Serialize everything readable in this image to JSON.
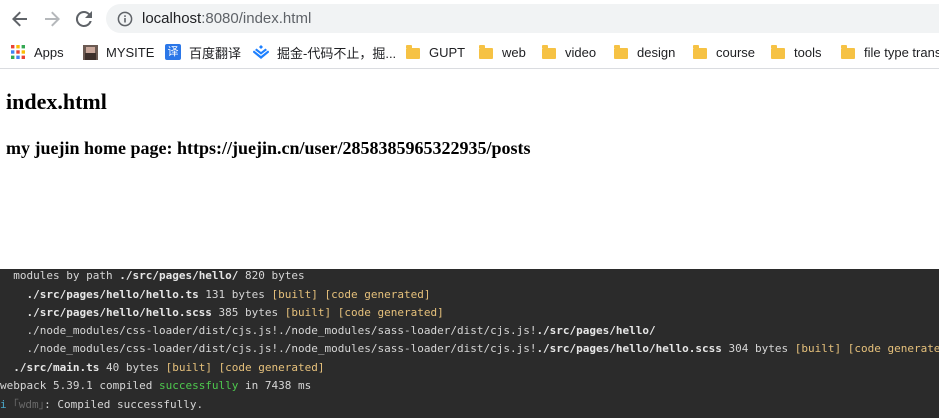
{
  "browser": {
    "url_host": "localhost",
    "url_rest": ":8080/index.html",
    "bookmarks": [
      {
        "label": "Apps",
        "icon": "apps-grid-icon"
      },
      {
        "label": "MYSITE",
        "icon": "mysite-favicon"
      },
      {
        "label": "百度翻译",
        "icon": "baidu-translate-icon"
      },
      {
        "label": "掘金-代码不止，掘...",
        "icon": "juejin-icon"
      },
      {
        "label": "GUPT",
        "icon": "folder-icon"
      },
      {
        "label": "web",
        "icon": "folder-icon"
      },
      {
        "label": "video",
        "icon": "folder-icon"
      },
      {
        "label": "design",
        "icon": "folder-icon"
      },
      {
        "label": "course",
        "icon": "folder-icon"
      },
      {
        "label": "tools",
        "icon": "folder-icon"
      },
      {
        "label": "file type trans",
        "icon": "folder-icon"
      }
    ],
    "translate_glyph": "译"
  },
  "page": {
    "heading": "index.html",
    "subheading": "my juejin home page: https://juejin.cn/user/2858385965322935/posts"
  },
  "terminal": {
    "line1": {
      "prefix": "  modules by path ",
      "path": "./src/pages/hello/",
      "suffix": " 820 bytes"
    },
    "line2": {
      "indent": "    ",
      "path": "./src/pages/hello/hello.ts",
      "size": " 131 bytes ",
      "built": "[built]",
      "gen": "[code generated]"
    },
    "line3": {
      "indent": "    ",
      "path": "./src/pages/hello/hello.scss",
      "size": " 385 bytes ",
      "built": "[built]",
      "gen": "[code generated]"
    },
    "line4": {
      "indent": "    ",
      "loader": "./node_modules/css-loader/dist/cjs.js!./node_modules/sass-loader/dist/cjs.js!",
      "path": "./src/pages/hello/"
    },
    "line5": {
      "indent": "    ",
      "loader": "./node_modules/css-loader/dist/cjs.js!./node_modules/sass-loader/dist/cjs.js!",
      "path": "./src/pages/hello/hello.scss",
      "size": " 304 bytes ",
      "built": "[built]",
      "gen": "[code generated]"
    },
    "line6": {
      "indent": "  ",
      "path": "./src/main.ts",
      "size": " 40 bytes ",
      "built": "[built]",
      "gen": "[code generated]"
    },
    "line7": {
      "prefix": "webpack 5.39.1 compiled ",
      "status": "successfully",
      "suffix": " in 7438 ms"
    },
    "line8": {
      "i": "i",
      "wdm": "｢wdm｣",
      "msg": ": Compiled successfully."
    }
  },
  "colors": {
    "terminal_bg": "#2b2b2b",
    "built_tag": "#e5c07b",
    "success": "#4ec94e",
    "info": "#4aa8c9"
  }
}
